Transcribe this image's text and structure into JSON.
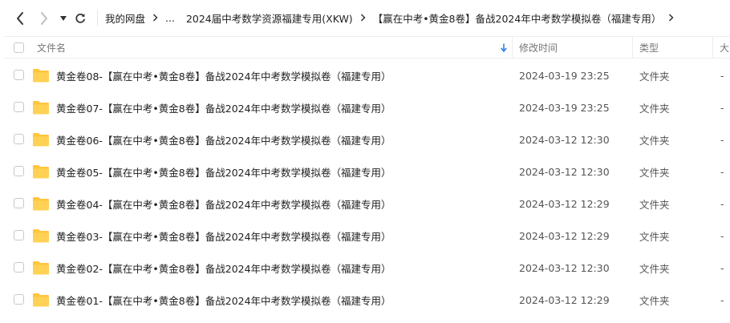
{
  "breadcrumb": {
    "items": [
      "我的网盘",
      "...",
      "2024届中考数学资源福建专用(XKW)",
      "【赢在中考•黄金8卷】备战2024年中考数学模拟卷（福建专用）"
    ]
  },
  "columns": {
    "name": "文件名",
    "modified": "修改时间",
    "type": "类型",
    "size": "大"
  },
  "files": [
    {
      "name": "黄金卷08-【赢在中考•黄金8卷】备战2024年中考数学模拟卷（福建专用）",
      "modified": "2024-03-19 23:25",
      "type": "文件夹",
      "size": "-"
    },
    {
      "name": "黄金卷07-【赢在中考•黄金8卷】备战2024年中考数学模拟卷（福建专用）",
      "modified": "2024-03-19 23:25",
      "type": "文件夹",
      "size": "-"
    },
    {
      "name": "黄金卷06-【赢在中考•黄金8卷】备战2024年中考数学模拟卷（福建专用）",
      "modified": "2024-03-12 12:30",
      "type": "文件夹",
      "size": "-"
    },
    {
      "name": "黄金卷05-【赢在中考•黄金8卷】备战2024年中考数学模拟卷（福建专用）",
      "modified": "2024-03-12 12:30",
      "type": "文件夹",
      "size": "-"
    },
    {
      "name": "黄金卷04-【赢在中考•黄金8卷】备战2024年中考数学模拟卷（福建专用）",
      "modified": "2024-03-12 12:29",
      "type": "文件夹",
      "size": "-"
    },
    {
      "name": "黄金卷03-【赢在中考•黄金8卷】备战2024年中考数学模拟卷（福建专用）",
      "modified": "2024-03-12 12:29",
      "type": "文件夹",
      "size": "-"
    },
    {
      "name": "黄金卷02-【赢在中考•黄金8卷】备战2024年中考数学模拟卷（福建专用）",
      "modified": "2024-03-12 12:30",
      "type": "文件夹",
      "size": "-"
    },
    {
      "name": "黄金卷01-【赢在中考•黄金8卷】备战2024年中考数学模拟卷（福建专用）",
      "modified": "2024-03-12 12:29",
      "type": "文件夹",
      "size": "-"
    }
  ],
  "icons": {
    "back": "chevron-left-icon",
    "forward": "chevron-right-icon",
    "history": "caret-down-icon",
    "refresh": "refresh-icon",
    "sort": "arrow-down-icon",
    "folder": "folder-icon"
  },
  "colors": {
    "folder": "#FFC53D",
    "sort_arrow": "#2F80ED"
  }
}
